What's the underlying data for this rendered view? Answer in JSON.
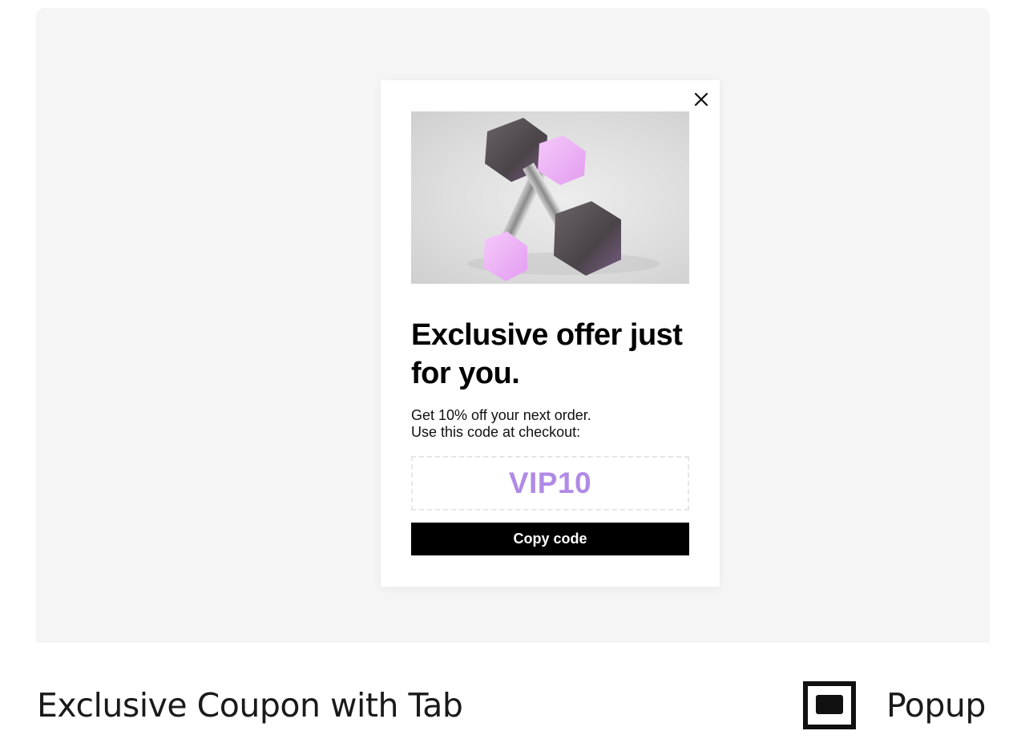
{
  "preview": {
    "popup": {
      "close_icon": "close-icon",
      "image_alt": "Two purple hex dumbbells",
      "headline": "Exclusive offer just for you.",
      "body_line1": "Get 10% off your next order.",
      "body_line2": "Use this code at checkout:",
      "coupon_code": "VIP10",
      "copy_button": "Copy code",
      "colors": {
        "coupon_code": "#b08ae6",
        "button_bg": "#000000",
        "button_text": "#ffffff"
      }
    }
  },
  "footer": {
    "template_name": "Exclusive Coupon with Tab",
    "type_icon": "popup-icon",
    "type_label": "Popup"
  }
}
